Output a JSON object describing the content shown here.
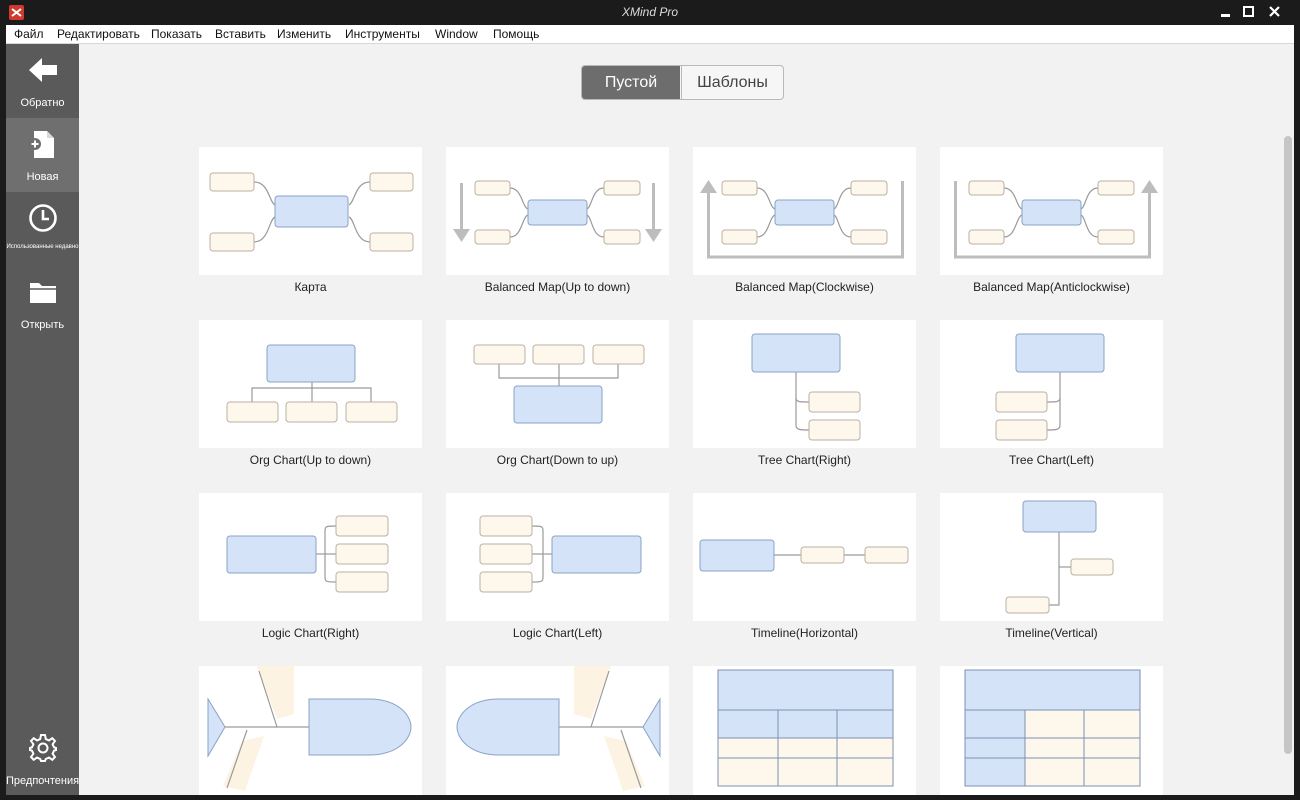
{
  "window": {
    "title": "XMind Pro"
  },
  "menu": [
    "Файл",
    "Редактировать",
    "Показать",
    "Вставить",
    "Изменить",
    "Инструменты",
    "Window",
    "Помощь"
  ],
  "sidebar": {
    "back": {
      "label": "Обратно",
      "icon": "arrow-left-icon"
    },
    "new": {
      "label": "Новая",
      "icon": "new-file-icon"
    },
    "recent": {
      "label": "Использованные недавно",
      "icon": "clock-icon"
    },
    "open": {
      "label": "Открыть",
      "icon": "folder-icon"
    },
    "preferences": {
      "label": "Предпочтения",
      "icon": "gear-icon"
    }
  },
  "tabs": {
    "blank": "Пустой",
    "templates": "Шаблоны",
    "selected": "Пустой"
  },
  "templates": [
    "Карта",
    "Balanced Map(Up to down)",
    "Balanced Map(Clockwise)",
    "Balanced Map(Anticlockwise)",
    "Org Chart(Up to down)",
    "Org Chart(Down to up)",
    "Tree Chart(Right)",
    "Tree Chart(Left)",
    "Logic Chart(Right)",
    "Logic Chart(Left)",
    "Timeline(Horizontal)",
    "Timeline(Vertical)"
  ],
  "colors": {
    "central_topic": "#d4e3f8",
    "subtopic": "#fdf7ec",
    "sidebar": "#5a5a5a",
    "sidebar_active": "#6f6f6f",
    "tab_selected": "#6d6d6d",
    "logo": "#d03a2e"
  }
}
